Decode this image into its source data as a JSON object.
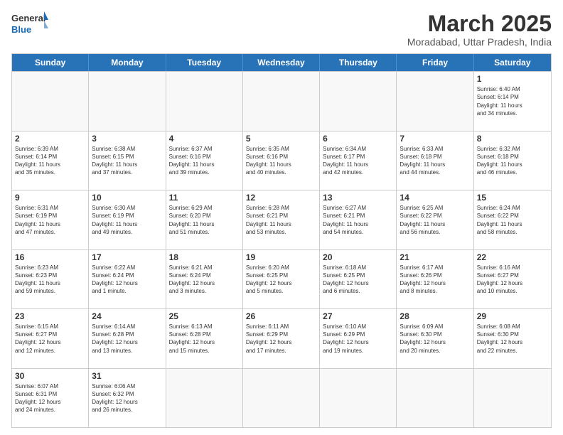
{
  "header": {
    "logo_general": "General",
    "logo_blue": "Blue",
    "month_title": "March 2025",
    "subtitle": "Moradabad, Uttar Pradesh, India"
  },
  "weekdays": [
    "Sunday",
    "Monday",
    "Tuesday",
    "Wednesday",
    "Thursday",
    "Friday",
    "Saturday"
  ],
  "rows": [
    [
      {
        "day": "",
        "info": ""
      },
      {
        "day": "",
        "info": ""
      },
      {
        "day": "",
        "info": ""
      },
      {
        "day": "",
        "info": ""
      },
      {
        "day": "",
        "info": ""
      },
      {
        "day": "",
        "info": ""
      },
      {
        "day": "1",
        "info": "Sunrise: 6:40 AM\nSunset: 6:14 PM\nDaylight: 11 hours\nand 34 minutes."
      }
    ],
    [
      {
        "day": "2",
        "info": "Sunrise: 6:39 AM\nSunset: 6:14 PM\nDaylight: 11 hours\nand 35 minutes."
      },
      {
        "day": "3",
        "info": "Sunrise: 6:38 AM\nSunset: 6:15 PM\nDaylight: 11 hours\nand 37 minutes."
      },
      {
        "day": "4",
        "info": "Sunrise: 6:37 AM\nSunset: 6:16 PM\nDaylight: 11 hours\nand 39 minutes."
      },
      {
        "day": "5",
        "info": "Sunrise: 6:35 AM\nSunset: 6:16 PM\nDaylight: 11 hours\nand 40 minutes."
      },
      {
        "day": "6",
        "info": "Sunrise: 6:34 AM\nSunset: 6:17 PM\nDaylight: 11 hours\nand 42 minutes."
      },
      {
        "day": "7",
        "info": "Sunrise: 6:33 AM\nSunset: 6:18 PM\nDaylight: 11 hours\nand 44 minutes."
      },
      {
        "day": "8",
        "info": "Sunrise: 6:32 AM\nSunset: 6:18 PM\nDaylight: 11 hours\nand 46 minutes."
      }
    ],
    [
      {
        "day": "9",
        "info": "Sunrise: 6:31 AM\nSunset: 6:19 PM\nDaylight: 11 hours\nand 47 minutes."
      },
      {
        "day": "10",
        "info": "Sunrise: 6:30 AM\nSunset: 6:19 PM\nDaylight: 11 hours\nand 49 minutes."
      },
      {
        "day": "11",
        "info": "Sunrise: 6:29 AM\nSunset: 6:20 PM\nDaylight: 11 hours\nand 51 minutes."
      },
      {
        "day": "12",
        "info": "Sunrise: 6:28 AM\nSunset: 6:21 PM\nDaylight: 11 hours\nand 53 minutes."
      },
      {
        "day": "13",
        "info": "Sunrise: 6:27 AM\nSunset: 6:21 PM\nDaylight: 11 hours\nand 54 minutes."
      },
      {
        "day": "14",
        "info": "Sunrise: 6:25 AM\nSunset: 6:22 PM\nDaylight: 11 hours\nand 56 minutes."
      },
      {
        "day": "15",
        "info": "Sunrise: 6:24 AM\nSunset: 6:22 PM\nDaylight: 11 hours\nand 58 minutes."
      }
    ],
    [
      {
        "day": "16",
        "info": "Sunrise: 6:23 AM\nSunset: 6:23 PM\nDaylight: 11 hours\nand 59 minutes."
      },
      {
        "day": "17",
        "info": "Sunrise: 6:22 AM\nSunset: 6:24 PM\nDaylight: 12 hours\nand 1 minute."
      },
      {
        "day": "18",
        "info": "Sunrise: 6:21 AM\nSunset: 6:24 PM\nDaylight: 12 hours\nand 3 minutes."
      },
      {
        "day": "19",
        "info": "Sunrise: 6:20 AM\nSunset: 6:25 PM\nDaylight: 12 hours\nand 5 minutes."
      },
      {
        "day": "20",
        "info": "Sunrise: 6:18 AM\nSunset: 6:25 PM\nDaylight: 12 hours\nand 6 minutes."
      },
      {
        "day": "21",
        "info": "Sunrise: 6:17 AM\nSunset: 6:26 PM\nDaylight: 12 hours\nand 8 minutes."
      },
      {
        "day": "22",
        "info": "Sunrise: 6:16 AM\nSunset: 6:27 PM\nDaylight: 12 hours\nand 10 minutes."
      }
    ],
    [
      {
        "day": "23",
        "info": "Sunrise: 6:15 AM\nSunset: 6:27 PM\nDaylight: 12 hours\nand 12 minutes."
      },
      {
        "day": "24",
        "info": "Sunrise: 6:14 AM\nSunset: 6:28 PM\nDaylight: 12 hours\nand 13 minutes."
      },
      {
        "day": "25",
        "info": "Sunrise: 6:13 AM\nSunset: 6:28 PM\nDaylight: 12 hours\nand 15 minutes."
      },
      {
        "day": "26",
        "info": "Sunrise: 6:11 AM\nSunset: 6:29 PM\nDaylight: 12 hours\nand 17 minutes."
      },
      {
        "day": "27",
        "info": "Sunrise: 6:10 AM\nSunset: 6:29 PM\nDaylight: 12 hours\nand 19 minutes."
      },
      {
        "day": "28",
        "info": "Sunrise: 6:09 AM\nSunset: 6:30 PM\nDaylight: 12 hours\nand 20 minutes."
      },
      {
        "day": "29",
        "info": "Sunrise: 6:08 AM\nSunset: 6:30 PM\nDaylight: 12 hours\nand 22 minutes."
      }
    ],
    [
      {
        "day": "30",
        "info": "Sunrise: 6:07 AM\nSunset: 6:31 PM\nDaylight: 12 hours\nand 24 minutes."
      },
      {
        "day": "31",
        "info": "Sunrise: 6:06 AM\nSunset: 6:32 PM\nDaylight: 12 hours\nand 26 minutes."
      },
      {
        "day": "",
        "info": ""
      },
      {
        "day": "",
        "info": ""
      },
      {
        "day": "",
        "info": ""
      },
      {
        "day": "",
        "info": ""
      },
      {
        "day": "",
        "info": ""
      }
    ]
  ]
}
